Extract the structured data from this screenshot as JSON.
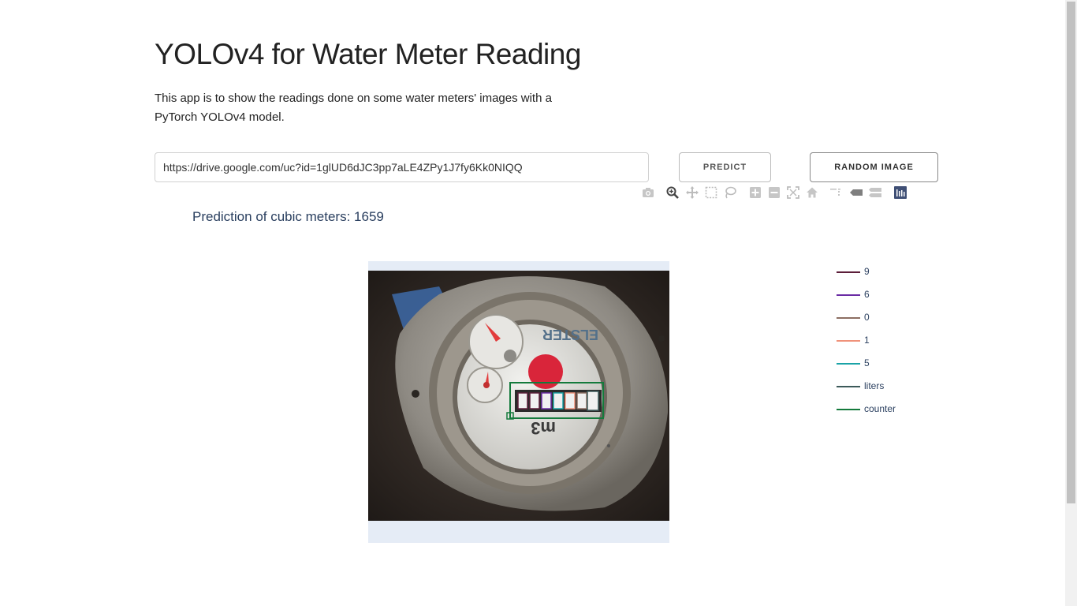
{
  "page": {
    "title": "YOLOv4 for Water Meter Reading",
    "description": "This app is to show the readings done on some water meters' images with a PyTorch YOLOv4 model."
  },
  "controls": {
    "url_value": "https://drive.google.com/uc?id=1glUD6dJC3pp7aLE4ZPy1J7fy6Kk0NIQQ",
    "predict_label": "PREDICT",
    "random_label": "RANDOM IMAGE"
  },
  "modebar": {
    "items": [
      {
        "icon": "camera-icon",
        "tooltip": "Download plot as a png"
      },
      {
        "icon": "zoom-icon",
        "tooltip": "Zoom"
      },
      {
        "icon": "pan-icon",
        "tooltip": "Pan"
      },
      {
        "icon": "box-select-icon",
        "tooltip": "Box Select"
      },
      {
        "icon": "lasso-select-icon",
        "tooltip": "Lasso Select"
      },
      {
        "icon": "zoom-in-icon",
        "tooltip": "Zoom in"
      },
      {
        "icon": "zoom-out-icon",
        "tooltip": "Zoom out"
      },
      {
        "icon": "autoscale-icon",
        "tooltip": "Autoscale"
      },
      {
        "icon": "home-icon",
        "tooltip": "Reset axes"
      },
      {
        "icon": "spike-lines-icon",
        "tooltip": "Toggle Spike Lines"
      },
      {
        "icon": "hover-closest-icon",
        "tooltip": "Show closest data on hover"
      },
      {
        "icon": "hover-compare-icon",
        "tooltip": "Compare data on hover"
      },
      {
        "icon": "plotly-logo-icon",
        "tooltip": "Produced with Plotly"
      }
    ]
  },
  "prediction": {
    "text": "Prediction of cubic meters: 1659"
  },
  "legend": {
    "items": [
      {
        "label": "9",
        "color": "#5c1e3a"
      },
      {
        "label": "6",
        "color": "#6a2ca4"
      },
      {
        "label": "0",
        "color": "#8c6e62"
      },
      {
        "label": "1",
        "color": "#f0927a"
      },
      {
        "label": "5",
        "color": "#1aa3a7"
      },
      {
        "label": "liters",
        "color": "#3c5a5a"
      },
      {
        "label": "counter",
        "color": "#147a3c"
      }
    ]
  },
  "image": {
    "meter_brand": "ELSTER",
    "unit_mark": "m3",
    "detected_digits": [
      "0",
      "1",
      "6",
      "5",
      "9",
      "2",
      "3"
    ]
  },
  "colors": {
    "text_dark": "#222222",
    "plot_text": "#2a3f5f",
    "plot_bg": "#e5ecf6",
    "modebar_icon": "#bcbcbc",
    "modebar_active": "#444444"
  }
}
